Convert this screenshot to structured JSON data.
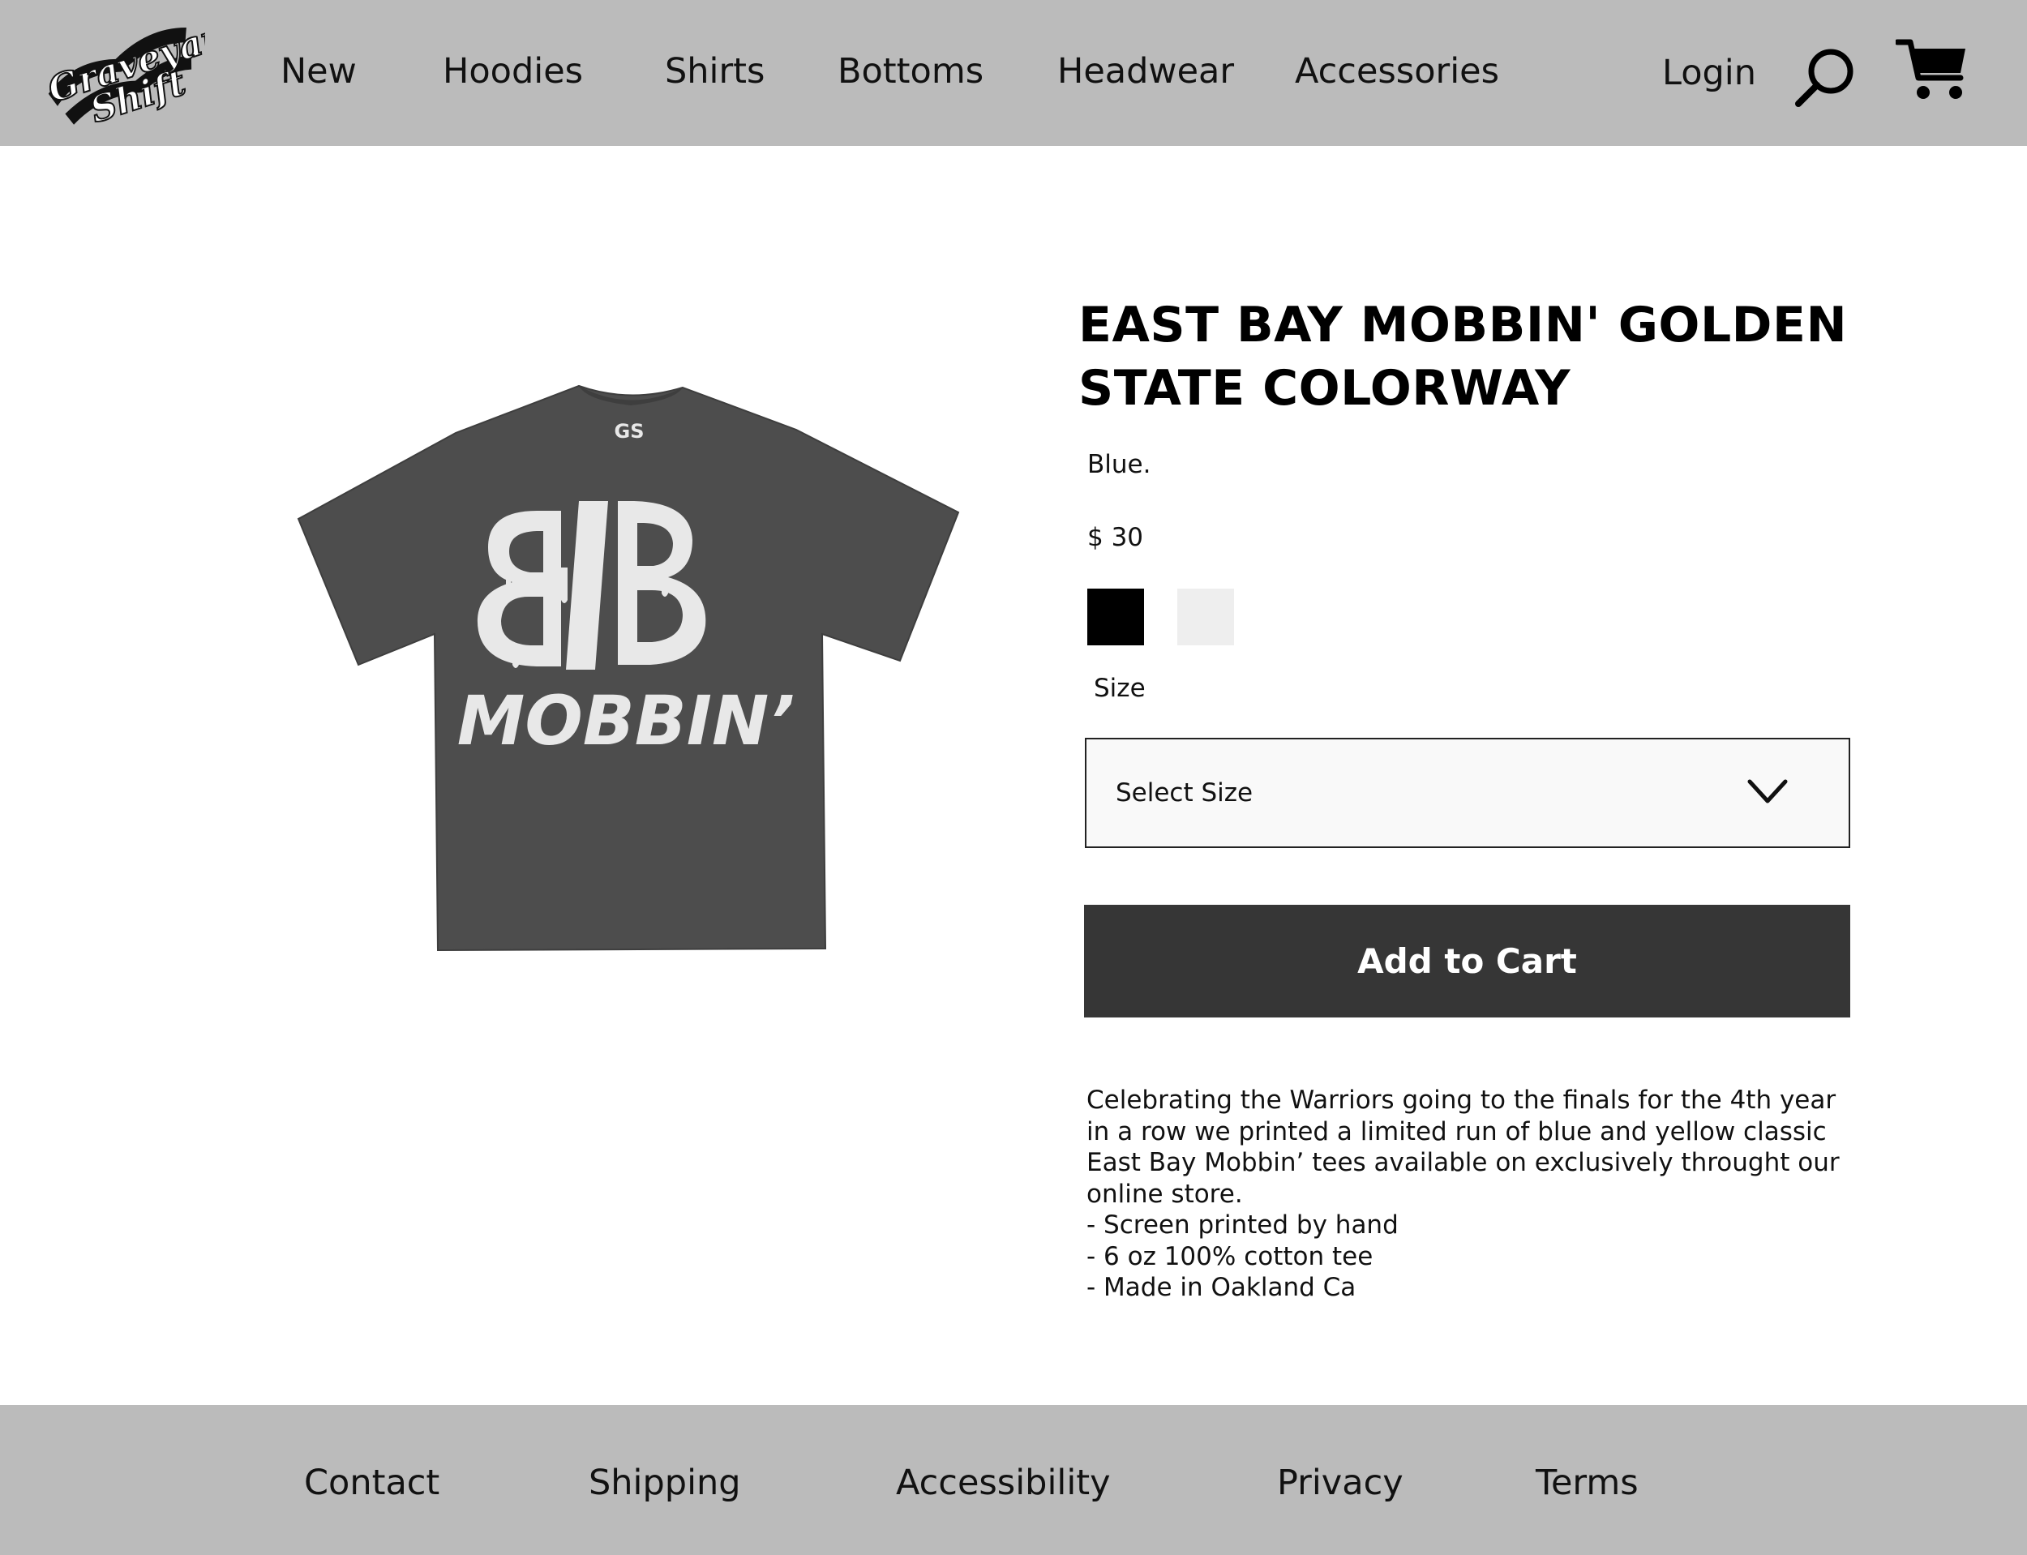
{
  "header": {
    "logo_text": "Graveyard Shift",
    "nav": [
      {
        "label": "New"
      },
      {
        "label": "Hoodies"
      },
      {
        "label": "Shirts"
      },
      {
        "label": "Bottoms"
      },
      {
        "label": "Headwear"
      },
      {
        "label": "Accessories"
      }
    ],
    "login_label": "Login",
    "search_icon": "search-icon",
    "cart_icon": "cart-icon"
  },
  "product": {
    "image": {
      "icon": "tshirt-image",
      "shirt_color": "#4d4d4d",
      "print_color": "#e8e8e8",
      "tag_text": "GS",
      "graphic_text": "MOBBIN’"
    },
    "title": "EAST BAY MOBBIN' GOLDEN STATE COLORWAY",
    "color_text": "Blue.",
    "price": "$ 30",
    "swatches": [
      {
        "name": "black",
        "color": "#000000"
      },
      {
        "name": "white",
        "color": "#eeeeee"
      }
    ],
    "size_label": "Size",
    "size_select": {
      "value": "Select Size",
      "icon": "chevron-down-icon"
    },
    "add_to_cart_label": "Add to Cart",
    "description_lines": [
      "Celebrating the Warriors going to the finals for the 4th year",
      "in a row we printed a limited run of blue and yellow classic",
      "East Bay Mobbin’ tees available on exclusively throught our",
      "online store.",
      "- Screen printed by hand",
      "- 6 oz 100% cotton tee",
      "- Made in Oakland Ca"
    ]
  },
  "footer": {
    "links": [
      {
        "label": "Contact"
      },
      {
        "label": "Shipping"
      },
      {
        "label": "Accessibility"
      },
      {
        "label": "Privacy"
      },
      {
        "label": "Terms"
      }
    ]
  },
  "colors": {
    "header_bg": "#bbbbbb",
    "footer_bg": "#bbbbbb",
    "button_bg": "#363636",
    "button_text": "#ffffff"
  }
}
